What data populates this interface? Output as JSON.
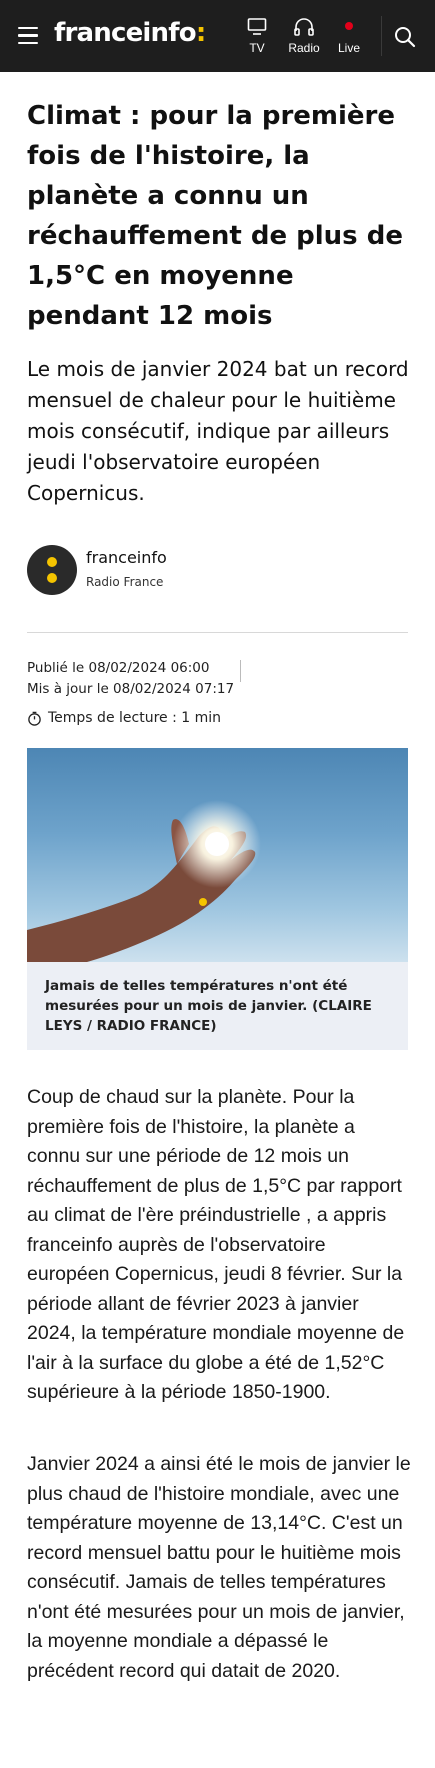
{
  "header": {
    "logo_text": "franceinfo",
    "logo_colon": ":",
    "nav": [
      {
        "label": "TV",
        "icon": "tv-icon"
      },
      {
        "label": "Radio",
        "icon": "headphones-icon"
      },
      {
        "label": "Live",
        "icon": "live-dot-icon"
      }
    ],
    "menu_icon": "menu-icon",
    "search_icon": "search-icon",
    "colors": {
      "background": "#1e1e1e",
      "accent": "#f5c400",
      "live": "#e2001a"
    }
  },
  "article": {
    "title": "Climat : pour la première fois de l'histoire, la planète a connu un réchauffement de plus de 1,5°C en moyenne pendant 12 mois",
    "lead": "Le mois de janvier 2024 bat un record mensuel de chaleur pour le huitième mois consécutif, indique par ailleurs jeudi l'observatoire européen Copernicus.",
    "author": {
      "name": "franceinfo",
      "organization": "Radio France"
    },
    "published": "Publié le 08/02/2024 06:00",
    "updated": "Mis à jour le 08/02/2024 07:17",
    "reading_time": "Temps de lecture : 1 min",
    "image_caption": "Jamais de telles températures n'ont été mesurées pour un mois de janvier. (CLAIRE LEYS / RADIO FRANCE)",
    "paragraphs": [
      "Coup de chaud sur la planète. Pour la première fois de l'histoire, la planète a connu sur une période de 12 mois un réchauffement de plus de 1,5°C par rapport au climat de l'ère préindustrielle , a appris franceinfo auprès de l'observatoire européen Copernicus, jeudi 8 février. Sur la période allant de février 2023 à janvier 2024, la température mondiale moyenne de l'air à la surface du globe a été de 1,52°C supérieure à la période 1850-1900.",
      "Janvier 2024 a ainsi été le mois de janvier le plus chaud de l'histoire mondiale, avec une température moyenne de 13,14°C. C'est un record mensuel battu pour le huitième mois consécutif. Jamais de telles températures n'ont été mesurées pour un mois de janvier, la moyenne mondiale a dépassé le précédent record qui datait de 2020."
    ]
  }
}
